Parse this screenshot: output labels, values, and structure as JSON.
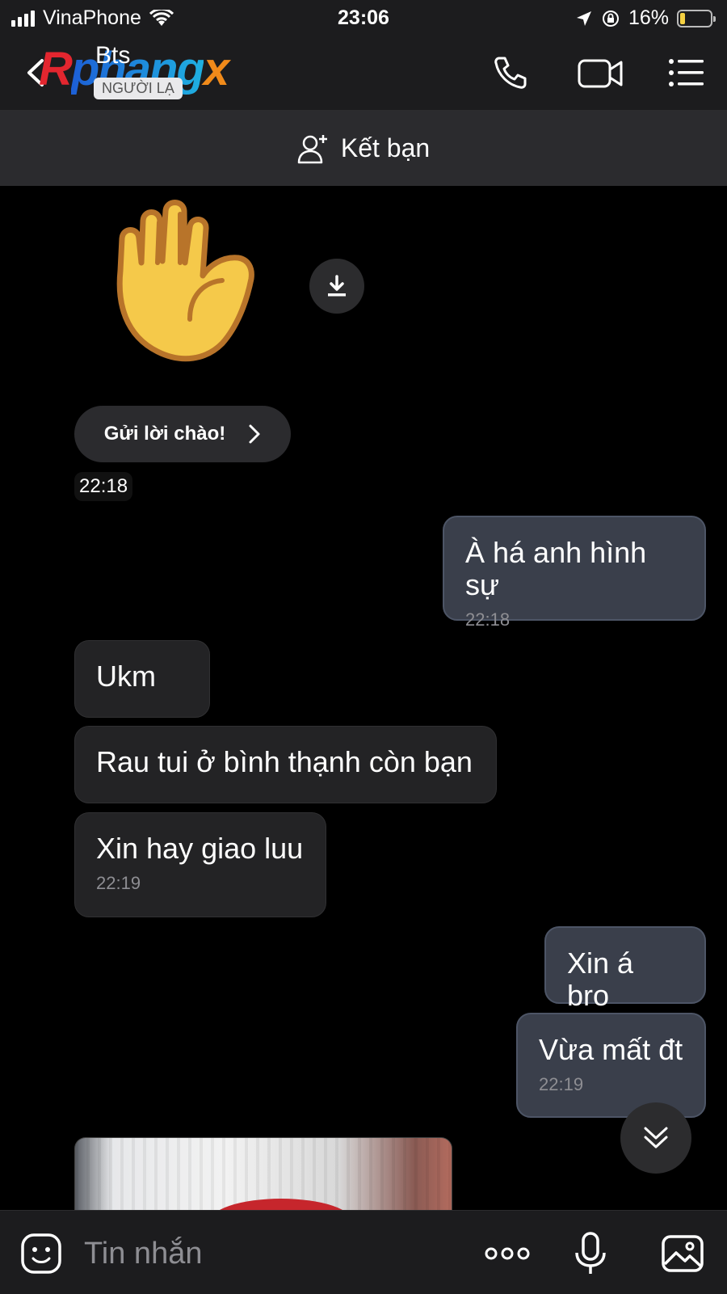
{
  "status_bar": {
    "carrier": "VinaPhone",
    "time": "23:06",
    "battery": "16%",
    "battery_level": 0.16
  },
  "header": {
    "logo": {
      "r": "R",
      "rest": "phang",
      "x": "x"
    },
    "contact_name": "Bts",
    "contact_badge": "NGƯỜI LẠ",
    "icons": [
      "back-icon",
      "phone-icon",
      "video-camera-icon",
      "menu-list-icon"
    ]
  },
  "friend_bar": {
    "label": "Kết bạn"
  },
  "greeting": {
    "button_label": "Gửi lời chào!",
    "time": "22:18"
  },
  "messages": [
    {
      "dir": "out",
      "text": "À há anh hình sự",
      "time": "22:18"
    },
    {
      "dir": "in",
      "text": "Ukm"
    },
    {
      "dir": "in",
      "text": "Rau tui ở bình thạnh còn bạn"
    },
    {
      "dir": "in",
      "text": "Xin hay giao luu",
      "time": "22:19"
    },
    {
      "dir": "out",
      "text": "Xin á bro"
    },
    {
      "dir": "out",
      "text": "Vừa mất đt",
      "time": "22:19"
    }
  ],
  "composer": {
    "placeholder": "Tin nhắn"
  },
  "colors": {
    "background": "#000000",
    "bar": "#1c1c1e",
    "incoming_bubble": "#232325",
    "outgoing_bubble": "#3a3f4b",
    "outgoing_border": "#4d5566",
    "timestamp": "#8e8e93"
  }
}
